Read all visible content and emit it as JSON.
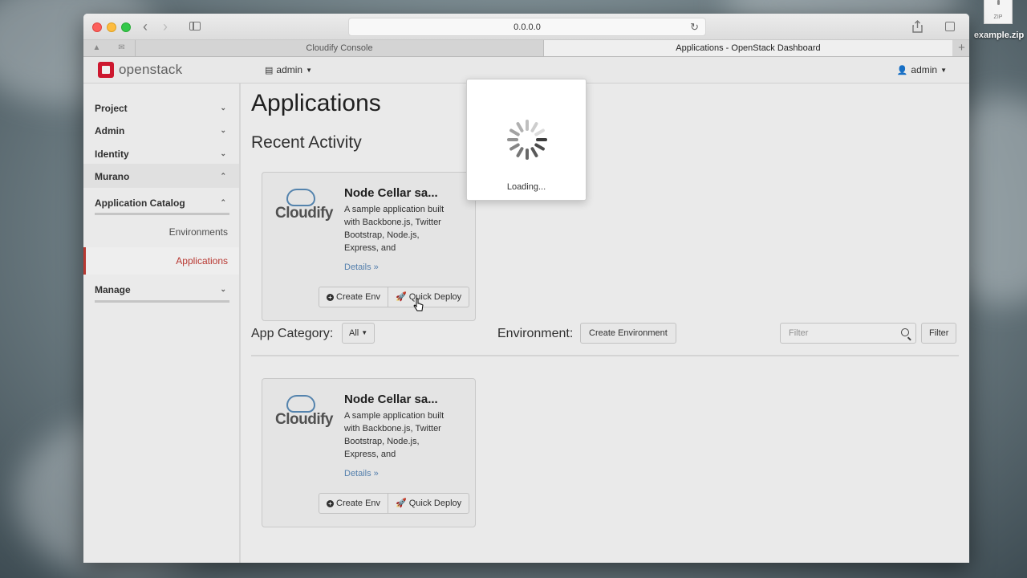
{
  "desktop": {
    "file_badge": "ZIP",
    "file_name": "example.zip"
  },
  "browser": {
    "url": "0.0.0.0",
    "tabs": [
      {
        "label": "Cloudify Console"
      },
      {
        "label": "Applications - OpenStack Dashboard"
      }
    ]
  },
  "header": {
    "logo_text": "openstack",
    "project_menu": "admin",
    "user_menu": "admin"
  },
  "sidebar": {
    "items": [
      {
        "label": "Project"
      },
      {
        "label": "Admin"
      },
      {
        "label": "Identity"
      },
      {
        "label": "Murano"
      },
      {
        "label": "Application Catalog"
      },
      {
        "label": "Environments"
      },
      {
        "label": "Applications"
      },
      {
        "label": "Manage"
      }
    ]
  },
  "main": {
    "title": "Applications",
    "recent_heading": "Recent Activity",
    "cards": [
      {
        "logo_text": "Cloudify",
        "title": "Node Cellar sa...",
        "description": "A sample application built with Backbone.js, Twitter Bootstrap, Node.js, Express, and",
        "details_link": "Details »",
        "create_env": "Create Env",
        "quick_deploy": "Quick Deploy"
      },
      {
        "logo_text": "Cloudify",
        "title": "Node Cellar sa...",
        "description": "A sample application built with Backbone.js, Twitter Bootstrap, Node.js, Express, and",
        "details_link": "Details »",
        "create_env": "Create Env",
        "quick_deploy": "Quick Deploy"
      }
    ],
    "app_category_label": "App Category:",
    "app_category_value": "All",
    "environment_label": "Environment:",
    "create_environment_button": "Create Environment",
    "filter_placeholder": "Filter",
    "filter_button": "Filter"
  },
  "modal": {
    "text": "Loading..."
  },
  "colors": {
    "accent": "#c43c35",
    "link": "#5b88b8",
    "logo_red": "#da1a32"
  }
}
